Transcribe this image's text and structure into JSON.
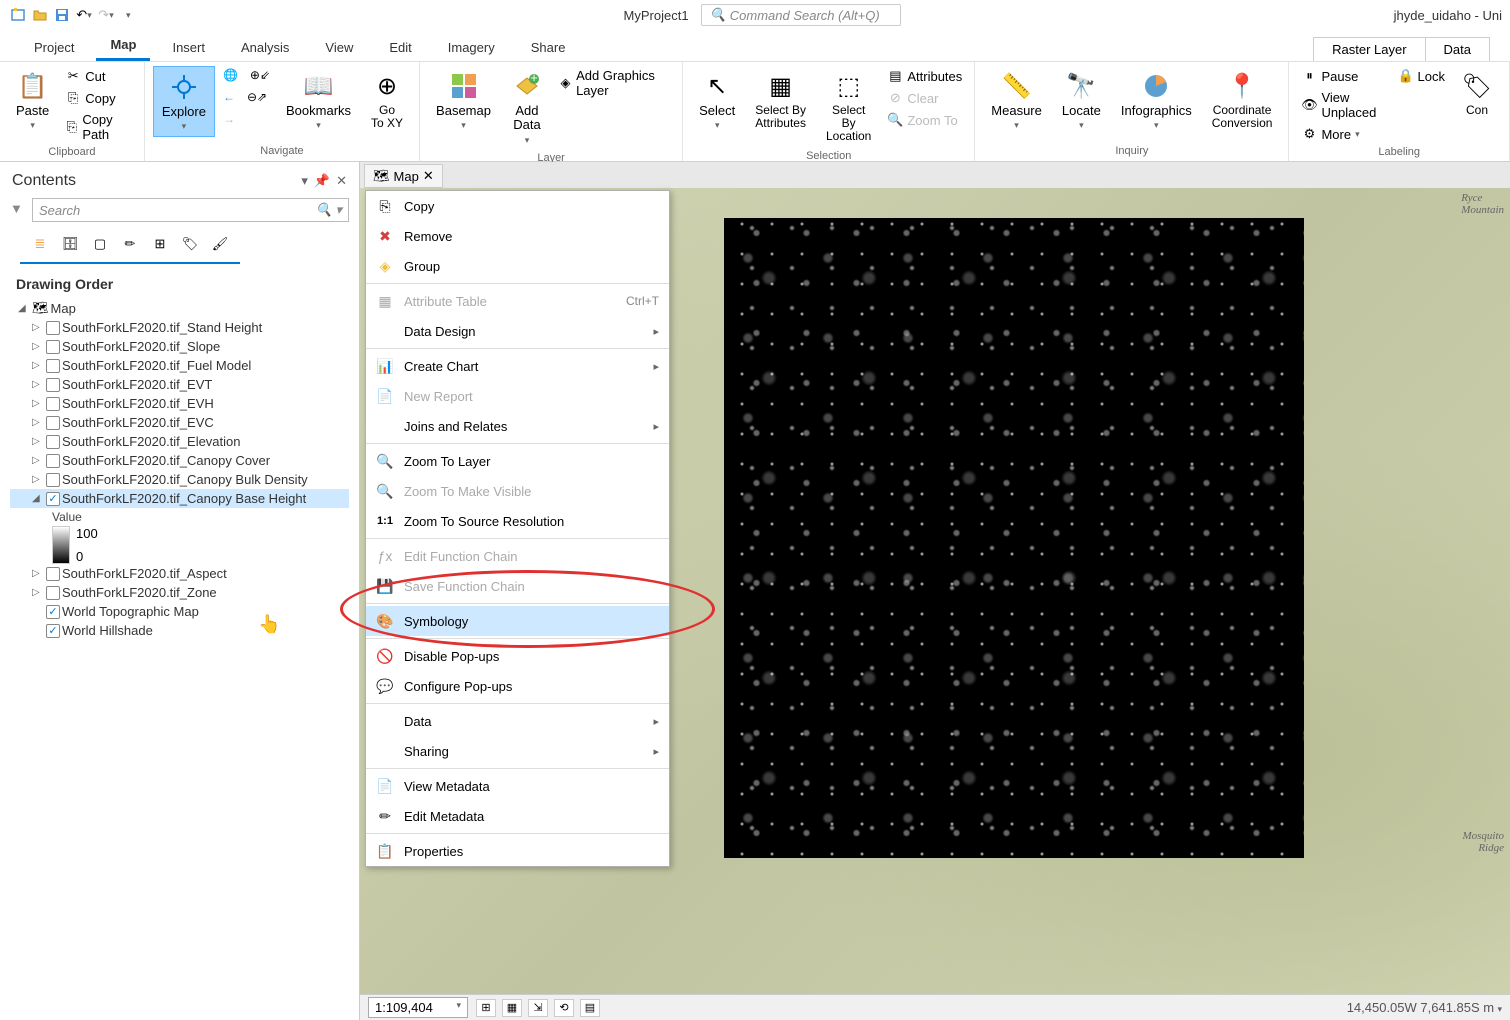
{
  "title_project": "MyProject1",
  "search_placeholder": "Command Search (Alt+Q)",
  "title_user": "jhyde_uidaho - Uni",
  "tabs": {
    "project": "Project",
    "map": "Map",
    "insert": "Insert",
    "analysis": "Analysis",
    "view": "View",
    "edit": "Edit",
    "imagery": "Imagery",
    "share": "Share",
    "raster_layer": "Raster Layer",
    "data": "Data"
  },
  "ribbon": {
    "clipboard": {
      "paste": "Paste",
      "cut": "Cut",
      "copy": "Copy",
      "copy_path": "Copy Path",
      "group": "Clipboard"
    },
    "navigate": {
      "explore": "Explore",
      "bookmarks": "Bookmarks",
      "go_to_xy": "Go\nTo XY",
      "group": "Navigate"
    },
    "layer": {
      "basemap": "Basemap",
      "add_data": "Add\nData",
      "add_graphics": "Add Graphics Layer",
      "group": "Layer"
    },
    "selection": {
      "select": "Select",
      "select_by_attributes": "Select By\nAttributes",
      "select_by_location": "Select By\nLocation",
      "attributes": "Attributes",
      "clear": "Clear",
      "zoom_to": "Zoom To",
      "group": "Selection"
    },
    "inquiry": {
      "measure": "Measure",
      "locate": "Locate",
      "infographics": "Infographics",
      "coordinate_conversion": "Coordinate\nConversion",
      "group": "Inquiry"
    },
    "labeling": {
      "pause": "Pause",
      "lock": "Lock",
      "view_unplaced": "View Unplaced",
      "more": "More",
      "con": "Con",
      "group": "Labeling"
    }
  },
  "contents": {
    "title": "Contents",
    "search": "Search",
    "drawing_order": "Drawing Order",
    "map": "Map",
    "layers": [
      "SouthForkLF2020.tif_Stand Height",
      "SouthForkLF2020.tif_Slope",
      "SouthForkLF2020.tif_Fuel Model",
      "SouthForkLF2020.tif_EVT",
      "SouthForkLF2020.tif_EVH",
      "SouthForkLF2020.tif_EVC",
      "SouthForkLF2020.tif_Elevation",
      "SouthForkLF2020.tif_Canopy Cover",
      "SouthForkLF2020.tif_Canopy Bulk Density"
    ],
    "selected_layer": "SouthForkLF2020.tif_Canopy Base Height",
    "value_label": "Value",
    "legend_high": "100",
    "legend_low": "0",
    "layers_after": [
      "SouthForkLF2020.tif_Aspect",
      "SouthForkLF2020.tif_Zone"
    ],
    "checked_layers": [
      "World Topographic Map",
      "World Hillshade"
    ]
  },
  "map_tab": "Map",
  "map_labels": {
    "ryce": "Ryce\nMountain",
    "mosquito": "Mosquito\nRidge"
  },
  "context_menu": {
    "copy": "Copy",
    "remove": "Remove",
    "group": "Group",
    "attribute_table": "Attribute Table",
    "attribute_shortcut": "Ctrl+T",
    "data_design": "Data Design",
    "create_chart": "Create Chart",
    "new_report": "New Report",
    "joins_relates": "Joins and Relates",
    "zoom_to_layer": "Zoom To Layer",
    "zoom_make_visible": "Zoom To Make Visible",
    "zoom_source_res": "Zoom To Source Resolution",
    "edit_function_chain": "Edit Function Chain",
    "save_function_chain": "Save Function Chain",
    "symbology": "Symbology",
    "disable_popups": "Disable Pop-ups",
    "configure_popups": "Configure Pop-ups",
    "data": "Data",
    "sharing": "Sharing",
    "view_metadata": "View Metadata",
    "edit_metadata": "Edit Metadata",
    "properties": "Properties"
  },
  "status": {
    "scale": "1:109,404",
    "coords": "14,450.05W 7,641.85S m"
  }
}
